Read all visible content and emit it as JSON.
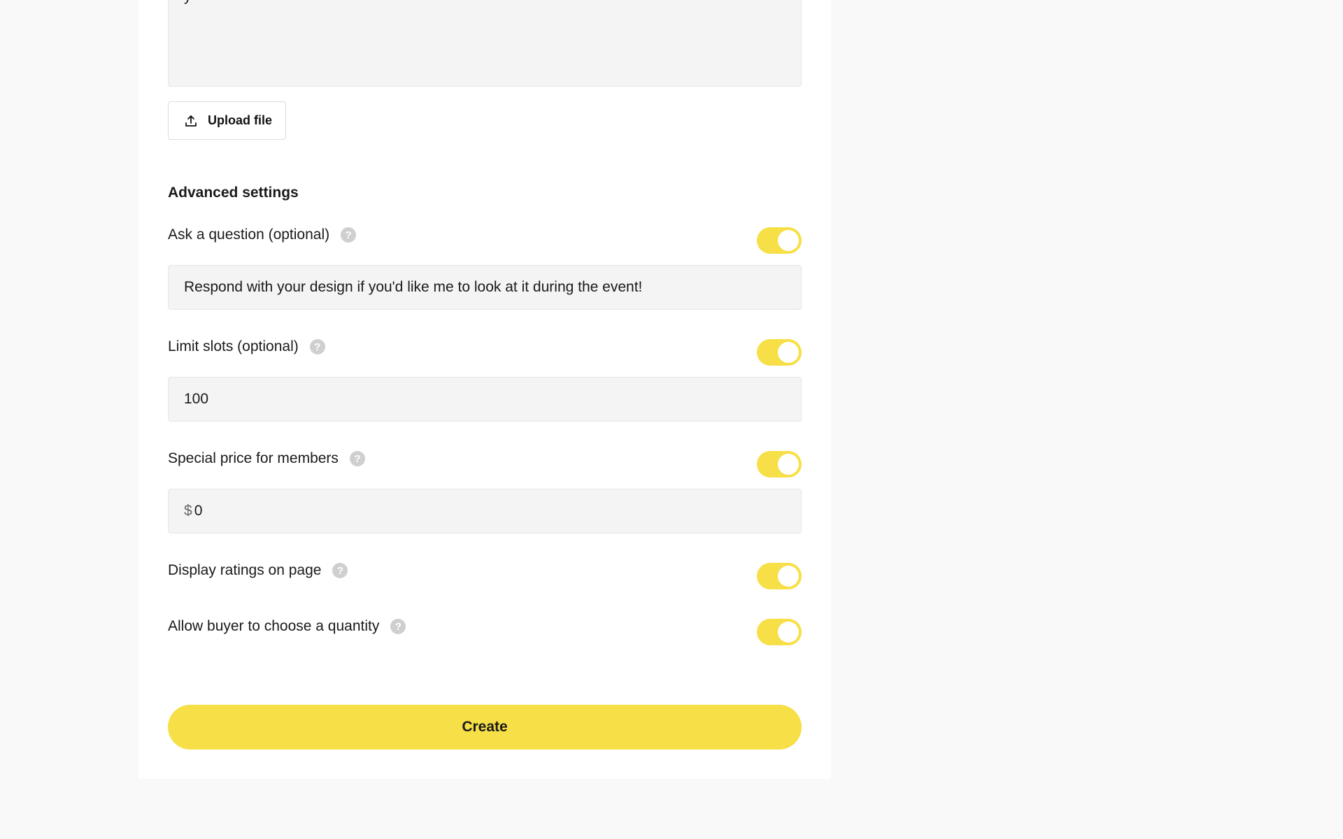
{
  "description_peek": "y",
  "upload": {
    "label": "Upload file"
  },
  "advanced": {
    "title": "Advanced settings",
    "ask_question": {
      "label": "Ask a question (optional)",
      "enabled": true,
      "value": "Respond with your design if you'd like me to look at it during the event!"
    },
    "limit_slots": {
      "label": "Limit slots (optional)",
      "enabled": true,
      "value": "100"
    },
    "special_price": {
      "label": "Special price for members",
      "enabled": true,
      "currency": "$",
      "value": "0"
    },
    "display_ratings": {
      "label": "Display ratings on page",
      "enabled": true
    },
    "allow_quantity": {
      "label": "Allow buyer to choose a quantity",
      "enabled": true
    }
  },
  "help_glyph": "?",
  "create": {
    "label": "Create"
  },
  "colors": {
    "accent": "#f7df47",
    "field_bg": "#f4f4f4",
    "page_bg": "#f9f9f9"
  }
}
